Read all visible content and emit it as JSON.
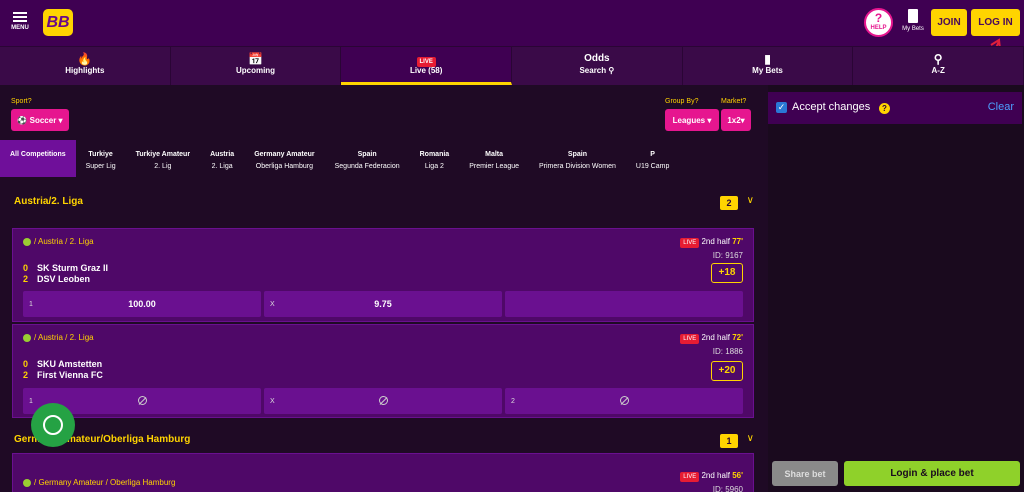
{
  "header": {
    "menu_label": "MENU",
    "logo_text": "BB",
    "help_label": "HELP",
    "mybets_label": "My Bets",
    "join_label": "JOIN",
    "login_label": "LOG IN"
  },
  "tabs": [
    {
      "label": "Highlights",
      "icon": "fire-icon"
    },
    {
      "label": "Upcoming",
      "icon": "calendar-icon"
    },
    {
      "label": "Live (58)",
      "badge": "LIVE",
      "active": true
    },
    {
      "title": "Odds",
      "label": "Search",
      "icon": "search-icon"
    },
    {
      "label": "My Bets",
      "icon": "ticket-icon"
    },
    {
      "label": "A-Z",
      "icon": "search-icon"
    }
  ],
  "filters": {
    "sport_label": "Sport?",
    "sport_value": "Soccer",
    "groupby_label": "Group By?",
    "groupby_value": "Leagues",
    "market_label": "Market?",
    "market_value": "1x2"
  },
  "competitions": [
    {
      "line1": "All Competitions",
      "line2": ""
    },
    {
      "line1": "Turkiye",
      "line2": "Super Lig"
    },
    {
      "line1": "Turkiye Amateur",
      "line2": "2. Lig"
    },
    {
      "line1": "Austria",
      "line2": "2. Liga"
    },
    {
      "line1": "Germany Amateur",
      "line2": "Oberliga Hamburg"
    },
    {
      "line1": "Spain",
      "line2": "Segunda Federacion"
    },
    {
      "line1": "Romania",
      "line2": "Liga 2"
    },
    {
      "line1": "Malta",
      "line2": "Premier League"
    },
    {
      "line1": "Spain",
      "line2": "Primera Division Women"
    },
    {
      "line1": "P",
      "line2": "U19 Camp"
    }
  ],
  "groups": [
    {
      "title": "Austria/2. Liga",
      "count": "2"
    },
    {
      "title": "Germany Amateur/Oberliga Hamburg",
      "count": "1"
    }
  ],
  "events": [
    {
      "path": "/ Austria / 2. Liga",
      "live_badge": "LIVE",
      "period": "2nd half",
      "minute": "77'",
      "id": "ID: 9167",
      "home_score": "0",
      "home": "SK Sturm Graz II",
      "away_score": "2",
      "away": "DSV Leoben",
      "more": "+18",
      "odds": [
        {
          "label": "1",
          "value": "100.00"
        },
        {
          "label": "X",
          "value": "9.75"
        },
        {
          "label": "",
          "value": ""
        }
      ]
    },
    {
      "path": "/ Austria / 2. Liga",
      "live_badge": "LIVE",
      "period": "2nd half",
      "minute": "72'",
      "id": "ID: 1886",
      "home_score": "0",
      "home": "SKU Amstetten",
      "away_score": "2",
      "away": "First Vienna FC",
      "more": "+20",
      "odds": [
        {
          "label": "1",
          "value": ""
        },
        {
          "label": "X",
          "value": ""
        },
        {
          "label": "2",
          "value": ""
        }
      ]
    },
    {
      "path": "/ Germany Amateur / Oberliga Hamburg",
      "live_badge": "LIVE",
      "period": "2nd half",
      "minute": "56'",
      "id": "ID: 5960"
    }
  ],
  "betslip": {
    "accept_label": "Accept changes",
    "clear_label": "Clear",
    "share_label": "Share bet",
    "place_label": "Login & place bet"
  },
  "colors": {
    "brand_yellow": "#ffd400",
    "brand_purple": "#3f0052",
    "pink": "#e6168f",
    "green_cta": "#8fd12a"
  }
}
